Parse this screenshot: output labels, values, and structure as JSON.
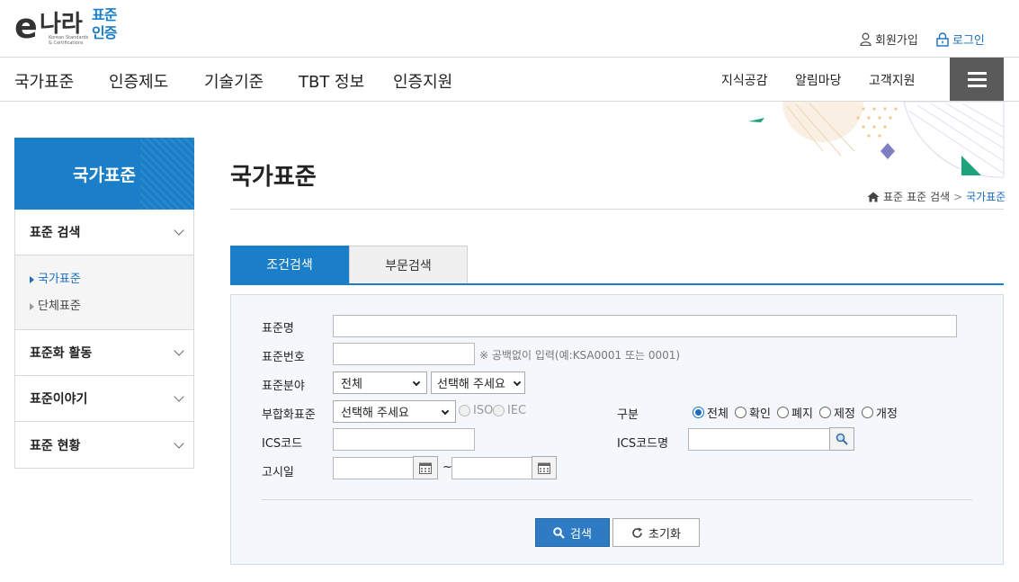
{
  "header": {
    "logo": {
      "e": "e",
      "nara": "나라",
      "pyojun": "표준",
      "injeung": "인증",
      "eng1": "Korean Standards",
      "eng2": "& Certifications"
    },
    "join_label": "회원가입",
    "login_label": "로그인"
  },
  "nav": {
    "main": [
      "국가표준",
      "인증제도",
      "기술기준",
      "TBT 정보",
      "인증지원"
    ],
    "sub": [
      "지식공감",
      "알림마당",
      "고객지원"
    ]
  },
  "sidebar": {
    "title": "국가표준",
    "sections": [
      {
        "label": "표준 검색",
        "children": [
          {
            "label": "국가표준",
            "active": true
          },
          {
            "label": "단체표준",
            "active": false
          }
        ]
      },
      {
        "label": "표준화 활동"
      },
      {
        "label": "표준이야기"
      },
      {
        "label": "표준 현황"
      }
    ]
  },
  "page": {
    "title": "국가표준",
    "breadcrumb": [
      "표준",
      "표준 검색",
      "국가표준"
    ]
  },
  "tabs": [
    {
      "label": "조건검색",
      "active": true
    },
    {
      "label": "부문검색",
      "active": false
    }
  ],
  "form": {
    "std_name_label": "표준명",
    "std_no_label": "표준번호",
    "std_no_hint": "※ 공백없이 입력(예:KSA0001 또는 0001)",
    "field_label": "표준분야",
    "field_select1": "전체",
    "field_select2": "선택해 주세요",
    "harmonized_label": "부합화표준",
    "harmonized_select": "선택해 주세요",
    "iso_label": "ISO",
    "iec_label": "IEC",
    "type_label": "구분",
    "type_options": [
      {
        "label": "전체",
        "selected": true
      },
      {
        "label": "확인",
        "selected": false
      },
      {
        "label": "폐지",
        "selected": false
      },
      {
        "label": "제정",
        "selected": false
      },
      {
        "label": "개정",
        "selected": false
      }
    ],
    "ics_label": "ICS코드",
    "ics_name_label": "ICS코드명",
    "notice_label": "고시일",
    "tilde": "~",
    "search_label": "검색",
    "reset_label": "초기화"
  },
  "colors": {
    "primary": "#1a7fc8",
    "menu_button": "#5a5a5a",
    "form_bg": "#f4f7fb"
  }
}
